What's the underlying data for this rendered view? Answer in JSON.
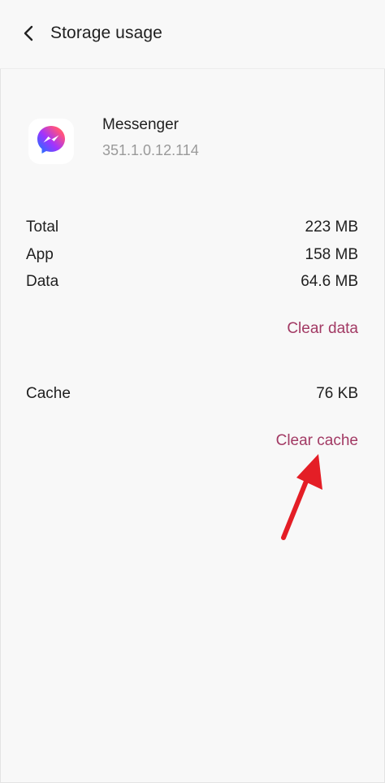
{
  "header": {
    "title": "Storage usage",
    "back_icon": "chevron-left-icon"
  },
  "app": {
    "name": "Messenger",
    "version": "351.1.0.12.114",
    "icon": "messenger-icon"
  },
  "storage": {
    "rows": [
      {
        "label": "Total",
        "value": "223 MB"
      },
      {
        "label": "App",
        "value": "158 MB"
      },
      {
        "label": "Data",
        "value": "64.6 MB"
      }
    ],
    "clear_data_label": "Clear data"
  },
  "cache": {
    "label": "Cache",
    "value": "76 KB",
    "clear_cache_label": "Clear cache"
  },
  "annotation": {
    "arrow_icon": "red-arrow-icon",
    "arrow_color": "#e41e26"
  },
  "colors": {
    "accent": "#a23a64",
    "background": "#f8f8f8",
    "secondary_text": "#9a9a9a"
  }
}
